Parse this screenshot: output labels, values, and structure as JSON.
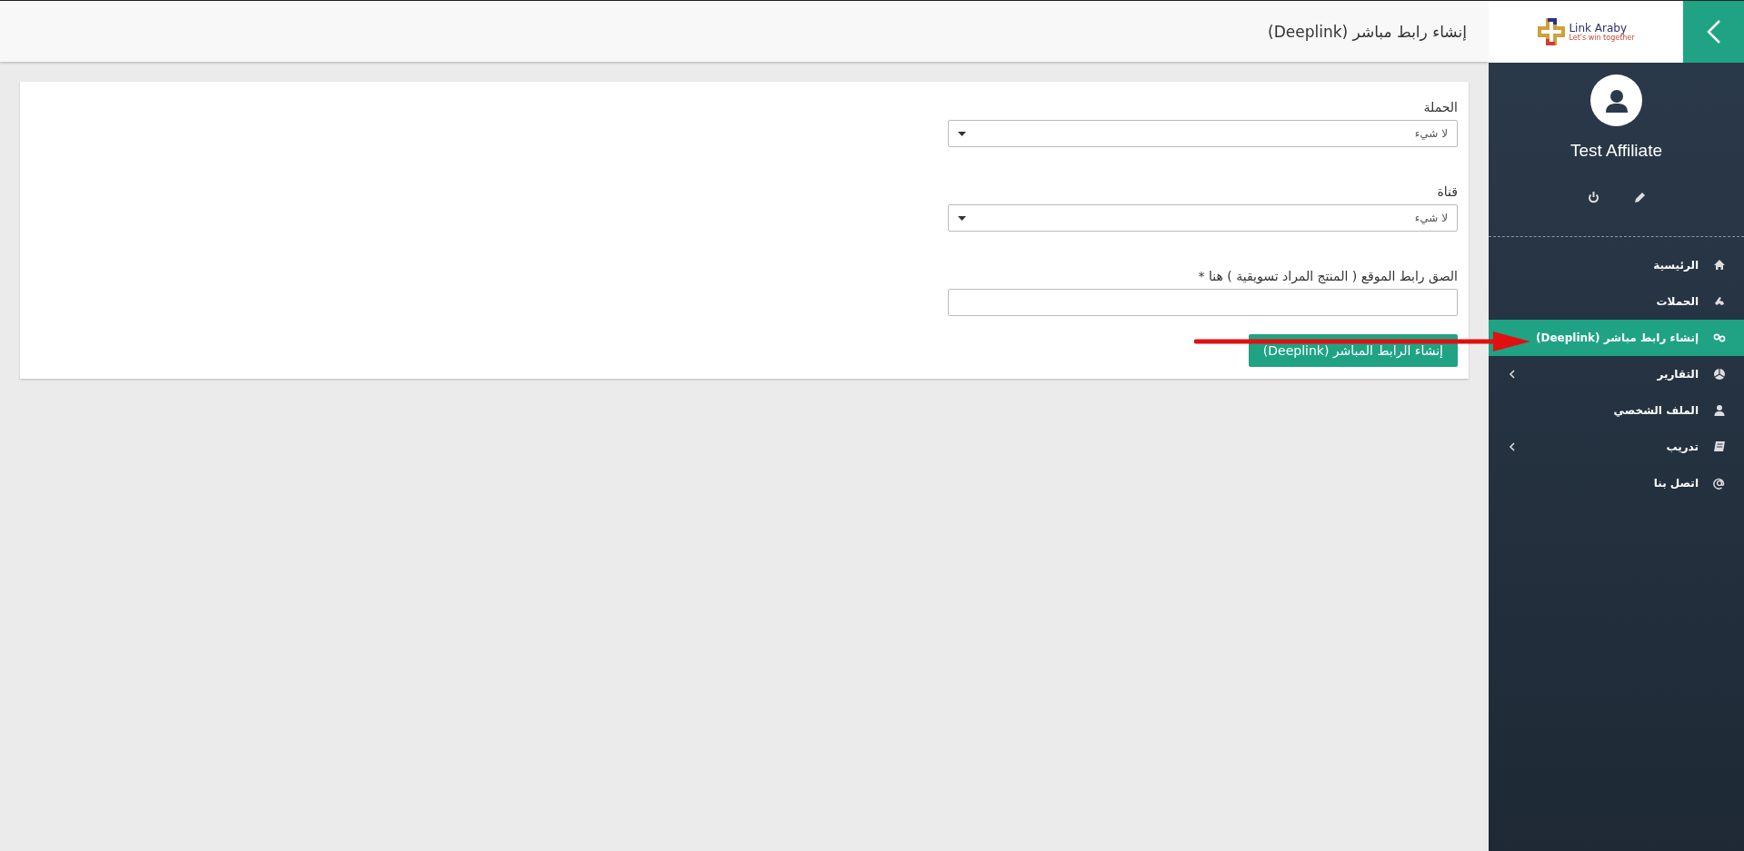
{
  "header": {
    "title": "إنشاء رابط مباشر (Deeplink)"
  },
  "form": {
    "fields": [
      {
        "kind": "select",
        "label": "الحملة",
        "value": "لا شيء"
      },
      {
        "kind": "select",
        "label": "قناة",
        "value": "لا شيء"
      },
      {
        "kind": "text",
        "label": "الصق رابط الموقع ( المنتج المراد تسويقية ) هنا *"
      }
    ],
    "submit": "إنشاء الرابط المباشر (Deeplink)"
  },
  "sidebar": {
    "logo": {
      "name": "Link Araby",
      "tagline": "Let's win together"
    },
    "user": {
      "name": "Test Affiliate"
    },
    "menu": [
      {
        "label": "الرئيسية",
        "selected": false,
        "expandable": false
      },
      {
        "label": "الحملات",
        "selected": false,
        "expandable": false
      },
      {
        "label": "إنشاء رابط مباشر (Deeplink)",
        "selected": true,
        "expandable": false
      },
      {
        "label": "التقارير",
        "selected": false,
        "expandable": true
      },
      {
        "label": "الملف الشخصي",
        "selected": false,
        "expandable": false
      },
      {
        "label": "تدريب",
        "selected": false,
        "expandable": true
      },
      {
        "label": "اتصل بنا",
        "selected": false,
        "expandable": false
      }
    ]
  }
}
